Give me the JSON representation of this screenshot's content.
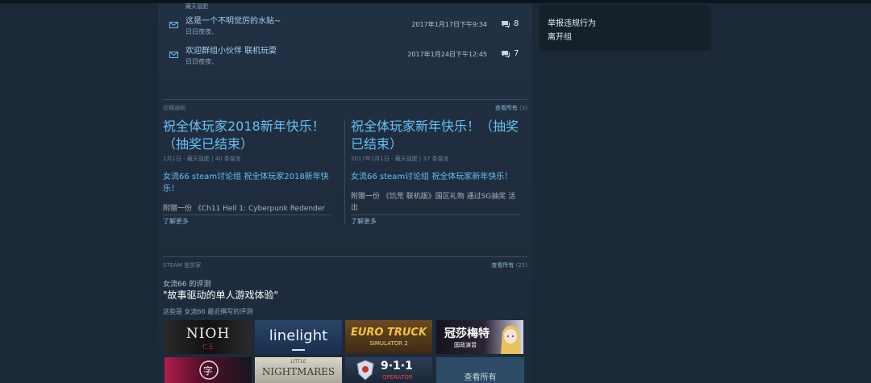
{
  "threads": {
    "cutoff_text": "藏天鼠肥",
    "items": [
      {
        "title": "这是一个不明觉厉的水贴~",
        "author": "日日夜夜、",
        "date": "2017年1月17日下午9:34",
        "replies": "8"
      },
      {
        "title": "欢迎群组小伙伴 联机玩耍",
        "author": "日日夜夜、",
        "date": "2017年1月24日下午12:45",
        "replies": "7"
      }
    ]
  },
  "sidebar": {
    "report_label": "举报违规行为",
    "leave_label": "离开组"
  },
  "announcements": {
    "section_label": "近期通知",
    "view_all": "查看所有",
    "count": "(3)",
    "items": [
      {
        "title": "祝全体玩家2018新年快乐！（抽奖已结束）",
        "meta": "1月1日 - 藏天鼠肥 | 40 条留言",
        "body": "女流66 steam讨论组 祝全体玩家2018新年快乐！",
        "excerpt": "附赠一份 《Ch11 Hell 1: Cyberpunk Redender",
        "read_more": "了解更多"
      },
      {
        "title": "祝全体玩家新年快乐！（抽奖已结束）",
        "meta": "2017年1月1日 - 藏天鼠肥 | 37 条留言",
        "body": "女流66 steam讨论组 祝全体玩家新年快乐！",
        "excerpt": "附赠一份 《饥荒 联机版》国区礼物 通过SG抽奖 活出",
        "read_more": "了解更多"
      }
    ]
  },
  "curator": {
    "section_label": "STEAM 鉴赏家",
    "view_all": "查看所有",
    "count": "(25)",
    "subtitle": "女流66 的评测",
    "title": "\"故事驱动的单人游戏体验\"",
    "desc": "这些是 女流66 最近撰写的评测",
    "view_all_tile": "查看所有"
  },
  "games": {
    "nioh": "NIOH",
    "nioh_sub": "仁王",
    "linelight": "linelight",
    "ets_line1": "EURO TRUCK",
    "ets_line2": "SIMULATOR 2",
    "root_letter": "冠莎梅特",
    "root_letter_sub": "国政演習",
    "rune": "字",
    "nightmares_small": "LITTLE",
    "nightmares": "NIGHTMARES",
    "operator_num": "9·1·1",
    "operator": "OPERATOR"
  },
  "colors": {
    "background": "#1b2838",
    "link": "#67c1f5",
    "panel": "#213043"
  }
}
